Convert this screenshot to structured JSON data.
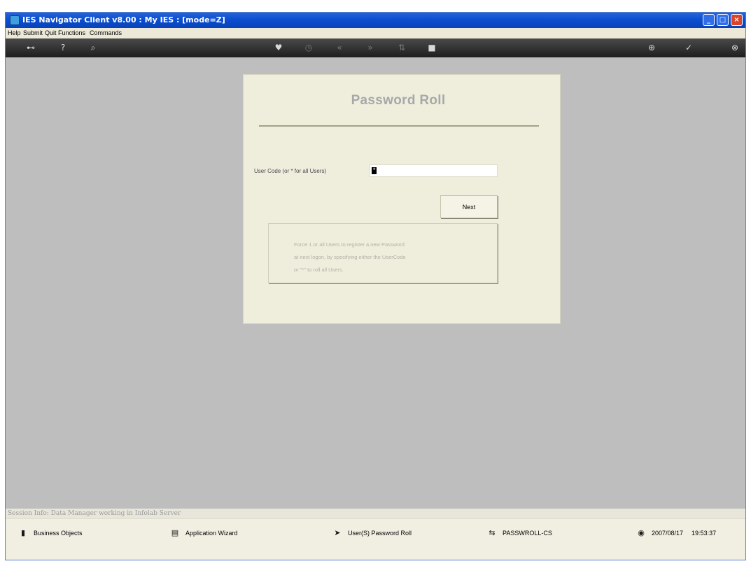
{
  "window": {
    "title": "IES Navigator Client v8.00 : My IES :      [mode=Z]",
    "controls": {
      "minimize": "_",
      "maximize": "□",
      "close": "×"
    }
  },
  "menu": [
    "Help",
    "Submit",
    "Quit",
    "Functions",
    "Commands"
  ],
  "toolbar": {
    "icons": [
      "key-icon",
      "help-icon",
      "search-icon",
      "heart-icon",
      "clock-icon",
      "rewind-icon",
      "fast-forward-icon",
      "sort-icon",
      "stop-icon",
      "add-icon",
      "check-icon",
      "close-icon"
    ],
    "glyphs": {
      "key": "⊷",
      "help": "?",
      "search": "⌕",
      "heart": "♥",
      "clock": "◷",
      "rewind": "«",
      "forward": "»",
      "sort": "⇅",
      "stop": "■",
      "add": "⊕",
      "check": "✓",
      "close": "⊗"
    }
  },
  "panel": {
    "title": "Password Roll",
    "user_code_label": "User Code (or * for all Users)",
    "user_code_value": "*",
    "next_label": "Next",
    "info_lines": [
      "Force 1 or all Users to register a new Password",
      "at next logon, by specifying either the UserCode",
      "or \"*\" to roll all Users."
    ]
  },
  "session_info": "Session Info: Data Manager working in Infolab Server",
  "status": {
    "business_objects": "Business Objects",
    "application_wizard": "Application Wizard",
    "users_password_roll": "User(S) Password Roll",
    "program_code": "PASSWROLL-CS",
    "date": "2007/08/17",
    "time": "19:53:37",
    "icons": {
      "business_objects": "▮",
      "application_wizard": "▤",
      "users_password_roll": "➤",
      "program_code": "⇆",
      "datetime": "◉"
    }
  }
}
